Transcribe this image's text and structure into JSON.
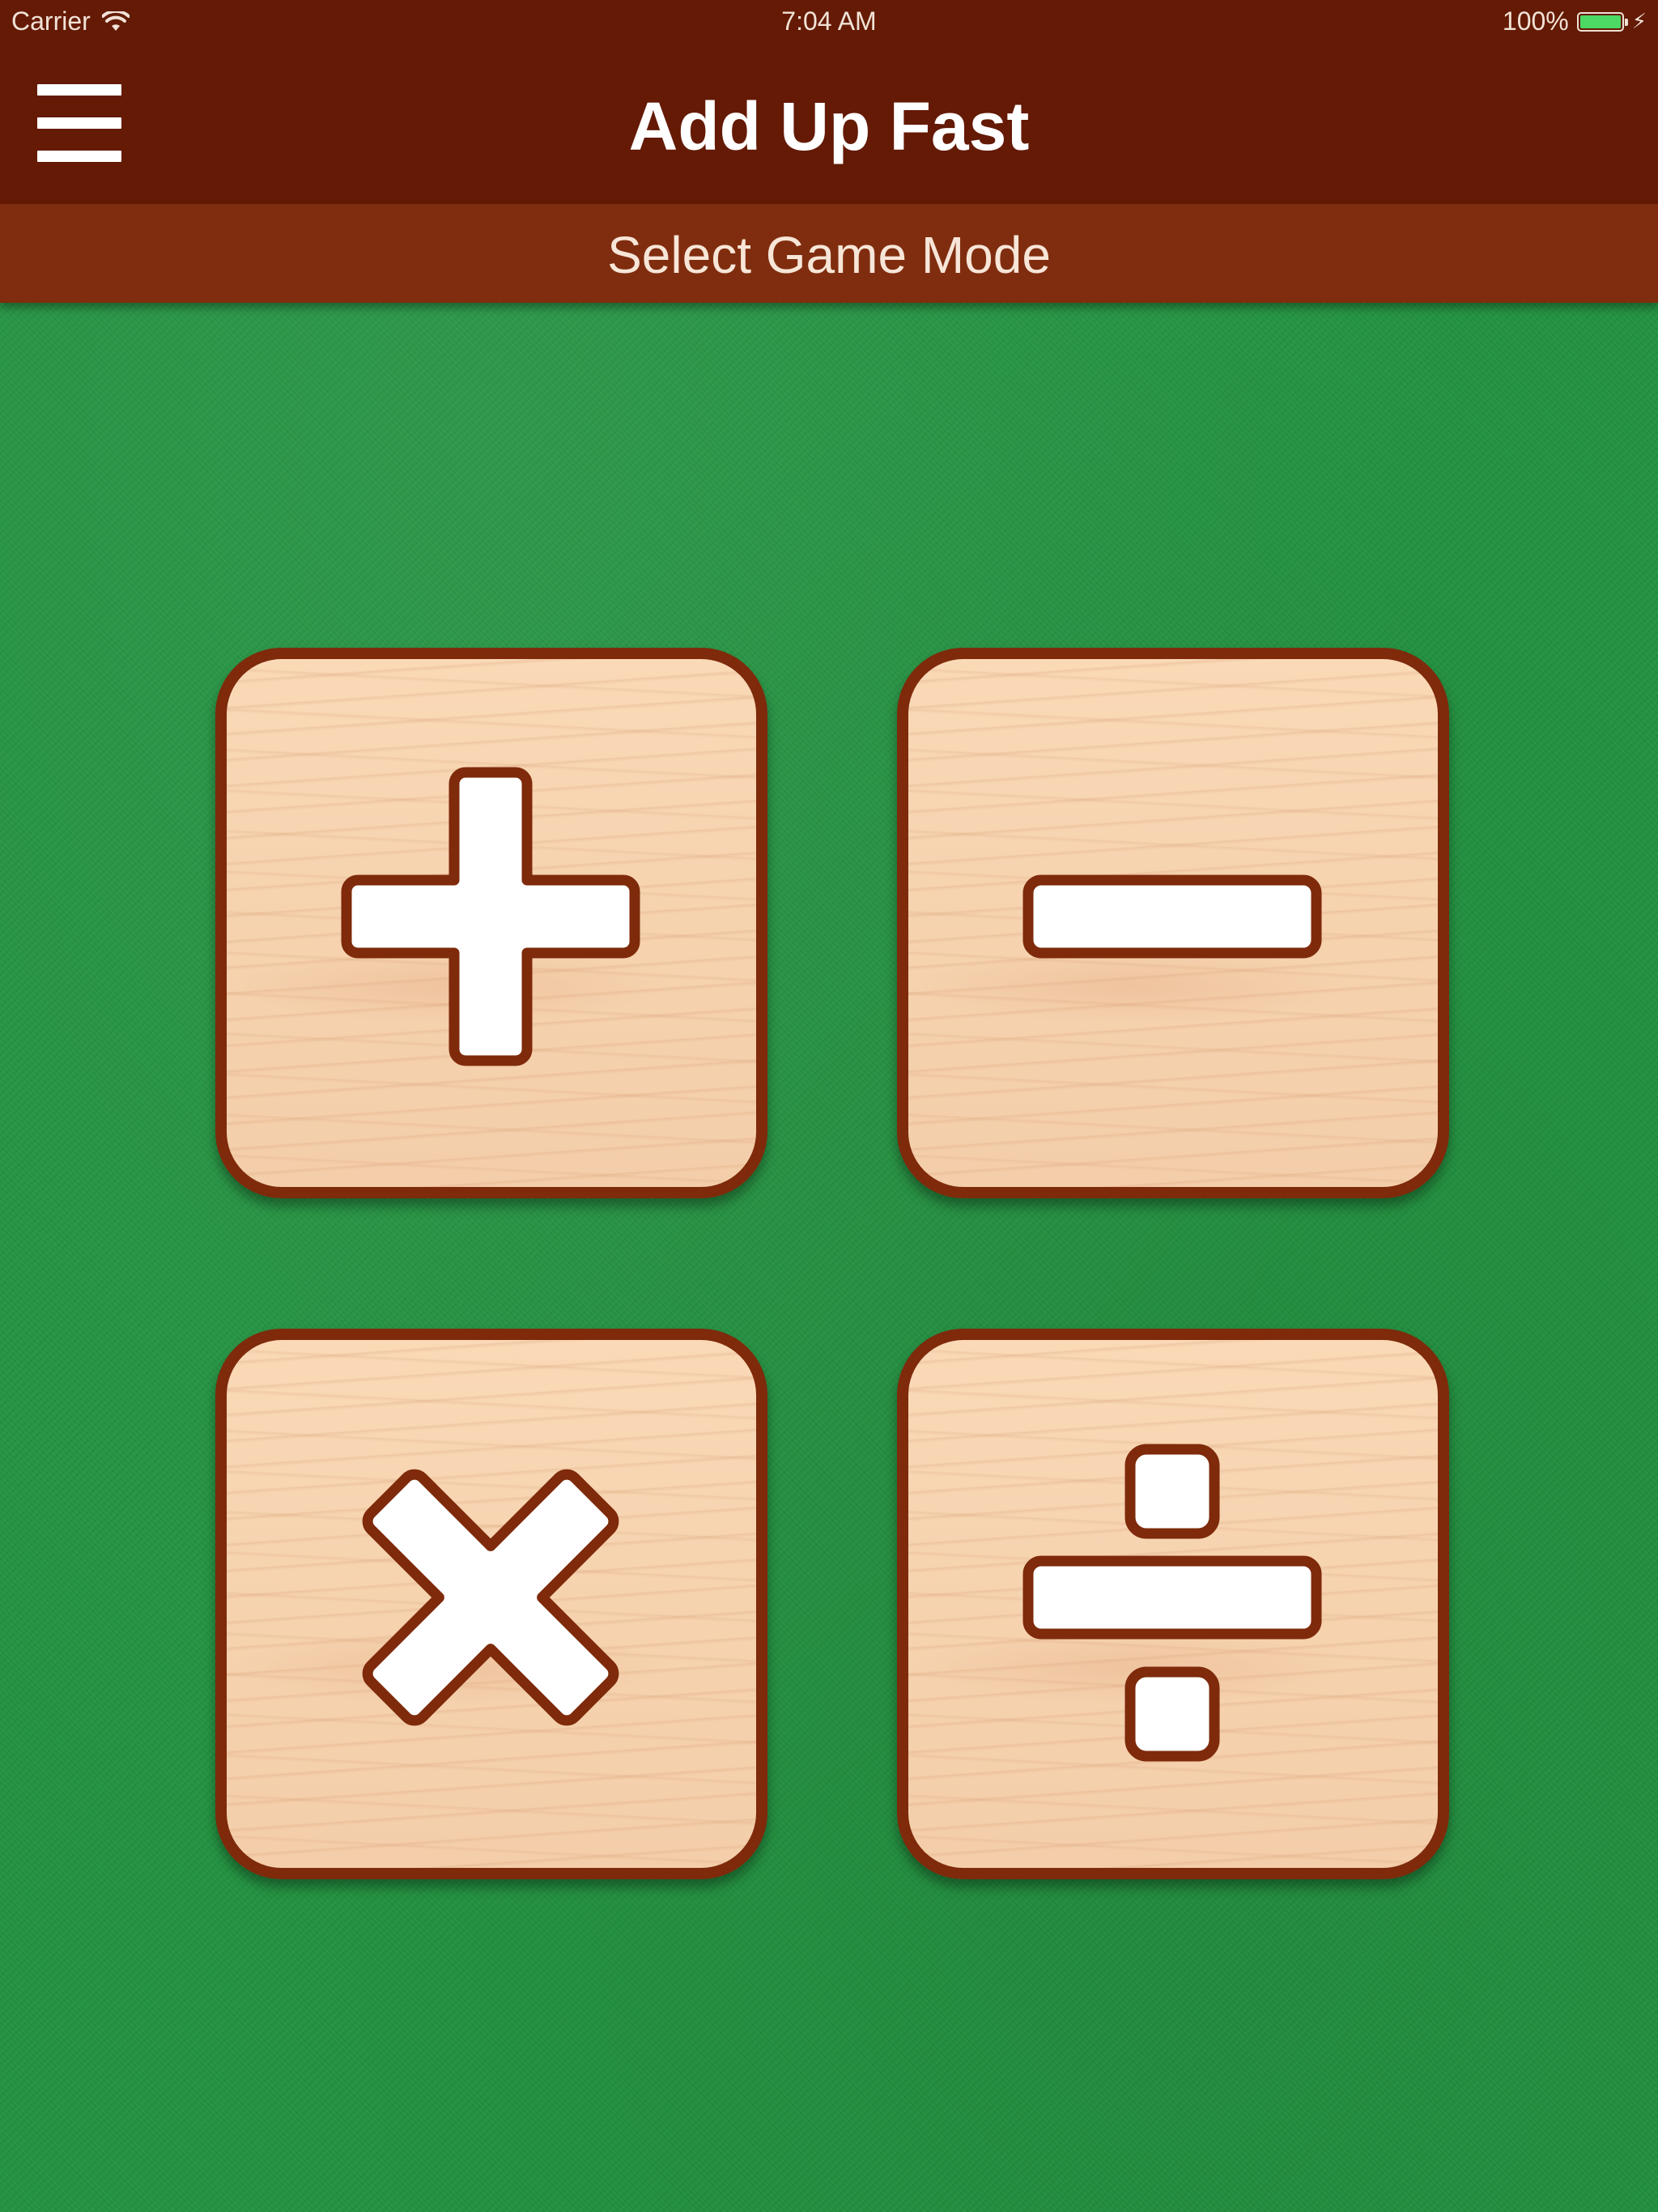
{
  "status_bar": {
    "carrier": "Carrier",
    "time": "7:04 AM",
    "battery": "100%",
    "icons": [
      "wifi-icon",
      "battery-icon",
      "charging-icon"
    ]
  },
  "nav_bar": {
    "title": "Add Up Fast",
    "menu_icon": "hamburger-menu-icon"
  },
  "sub_header": {
    "title": "Select Game Mode"
  },
  "game_modes": [
    {
      "icon": "plus-icon"
    },
    {
      "icon": "minus-icon"
    },
    {
      "icon": "multiply-icon"
    },
    {
      "icon": "divide-icon"
    }
  ],
  "colors": {
    "nav_bar": "#641a05",
    "sub_header": "#802d0f",
    "felt": "#22923f",
    "tile_border": "#7e2a0b",
    "tile_wood": "#f6d2ae",
    "symbol_fill": "#ffffff",
    "battery_fill": "#4cd964"
  }
}
